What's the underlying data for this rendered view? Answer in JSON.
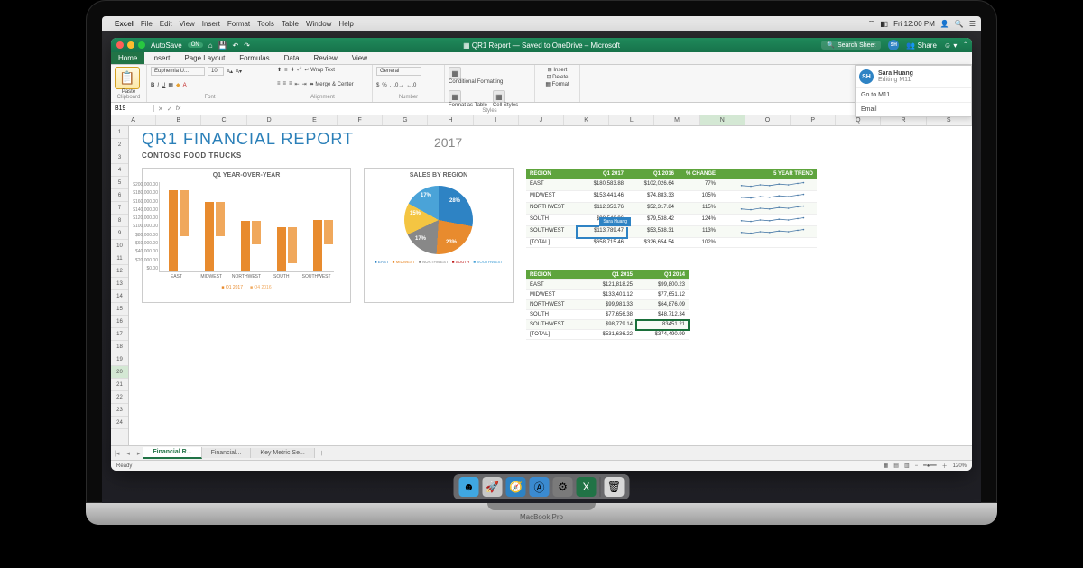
{
  "menubar": {
    "app": "Excel",
    "items": [
      "File",
      "Edit",
      "View",
      "Insert",
      "Format",
      "Tools",
      "Table",
      "Window",
      "Help"
    ],
    "clock": "Fri 12:00 PM"
  },
  "titlebar": {
    "autosave": "AutoSave",
    "autosave_state": "ON",
    "doc": "QR1 Report — Saved to OneDrive – Microsoft",
    "search_placeholder": "Search Sheet",
    "share": "Share"
  },
  "ribbon": {
    "tabs": [
      "Home",
      "Insert",
      "Page Layout",
      "Formulas",
      "Data",
      "Review",
      "View"
    ],
    "active_tab": "Home",
    "groups": {
      "clipboard": "Clipboard",
      "font": "Font",
      "alignment": "Alignment",
      "number": "Number",
      "styles": "Styles"
    },
    "paste": "Paste",
    "font_name": "Euphemia U...",
    "font_size": "10",
    "wrap": "Wrap Text",
    "merge": "Merge & Center",
    "num_format": "General",
    "cond_fmt": "Conditional Formatting",
    "fmt_table": "Format as Table",
    "cell_styles": "Cell Styles",
    "insert": "Insert",
    "delete": "Delete",
    "format": "Format"
  },
  "presence": {
    "initials": "SH",
    "name": "Sara Huang",
    "status": "Editing M11",
    "goto": "Go to M11",
    "email": "Email"
  },
  "fxrow": {
    "namebox": "B19",
    "fx": "fx"
  },
  "columns": [
    "A",
    "B",
    "C",
    "D",
    "E",
    "F",
    "G",
    "H",
    "I",
    "J",
    "K",
    "L",
    "M",
    "N",
    "O",
    "P",
    "Q",
    "R",
    "S"
  ],
  "active_col": "N",
  "rows_count": 24,
  "active_row": 20,
  "sheet": {
    "title": "QR1  FINANCIAL  REPORT",
    "subtitle": "CONTOSO FOOD TRUCKS",
    "year": "2017"
  },
  "chart_data": [
    {
      "type": "bar",
      "title": "Q1 YEAR-OVER-YEAR",
      "categories": [
        "EAST",
        "MIDWEST",
        "NORTHWEST",
        "SOUTH",
        "SOUTHWEST"
      ],
      "series": [
        {
          "name": "Q1 2017",
          "values": [
            180584,
            153442,
            112354,
            98546,
            113789
          ]
        },
        {
          "name": "Q4 2016",
          "values": [
            102027,
            74883,
            52318,
            79538,
            53538
          ]
        }
      ],
      "ylim": [
        0,
        200000
      ],
      "y_ticks": [
        "$200,000.00",
        "$180,000.00",
        "$160,000.00",
        "$140,000.00",
        "$120,000.00",
        "$100,000.00",
        "$80,000.00",
        "$60,000.00",
        "$40,000.00",
        "$20,000.00",
        "$0.00"
      ],
      "legend": [
        "Q1 2017",
        "Q4 2016"
      ]
    },
    {
      "type": "pie",
      "title": "SALES BY REGION",
      "categories": [
        "EAST",
        "MIDWEST",
        "NORTHWEST",
        "SOUTH",
        "SOUTHWEST"
      ],
      "values": [
        28,
        23,
        17,
        15,
        17
      ],
      "labels": [
        "28%",
        "23%",
        "17%",
        "15%",
        "17%"
      ],
      "legend": [
        "EAST",
        "MIDWEST",
        "NORTHWEST",
        "SOUTH",
        "SOUTHWEST"
      ]
    }
  ],
  "table1": {
    "headers": [
      "REGION",
      "Q1 2017",
      "Q1 2016",
      "% CHANGE",
      "5 YEAR TREND"
    ],
    "rows": [
      [
        "EAST",
        "$180,583.88",
        "$102,026.64",
        "77%"
      ],
      [
        "MIDWEST",
        "$153,441.46",
        "$74,883.33",
        "105%"
      ],
      [
        "NORTHWEST",
        "$112,353.76",
        "$52,317.84",
        "115%"
      ],
      [
        "SOUTH",
        "$98,546.96",
        "$79,538.42",
        "124%"
      ],
      [
        "SOUTHWEST",
        "$113,789.47",
        "$53,538.31",
        "113%"
      ],
      [
        "[TOTAL]",
        "$658,715.46",
        "$326,654.54",
        "102%"
      ]
    ],
    "edit_row": 4,
    "edit_label": "Sara Huang"
  },
  "table2": {
    "headers": [
      "REGION",
      "Q1 2015",
      "Q1 2014"
    ],
    "rows": [
      [
        "EAST",
        "$121,818.25",
        "$99,800.23"
      ],
      [
        "MIDWEST",
        "$133,401.12",
        "$77,651.12"
      ],
      [
        "NORTHWEST",
        "$99,981.33",
        "$64,876.09"
      ],
      [
        "SOUTH",
        "$77,656.38",
        "$48,712.34"
      ],
      [
        "SOUTHWEST",
        "$98,779.14",
        "83451.21"
      ],
      [
        "[TOTAL]",
        "$531,636.22",
        "$374,490.99"
      ]
    ],
    "sel_row": 4,
    "sel_col": 2
  },
  "sheets": {
    "tabs": [
      "Financial R...",
      "Financial...",
      "Key Metric Se..."
    ],
    "active": 0
  },
  "status": {
    "ready": "Ready",
    "zoom": "120%"
  },
  "dock": [
    "finder",
    "launchpad",
    "safari",
    "appstore",
    "prefs",
    "excel",
    "trash"
  ],
  "brand": "MacBook Pro"
}
